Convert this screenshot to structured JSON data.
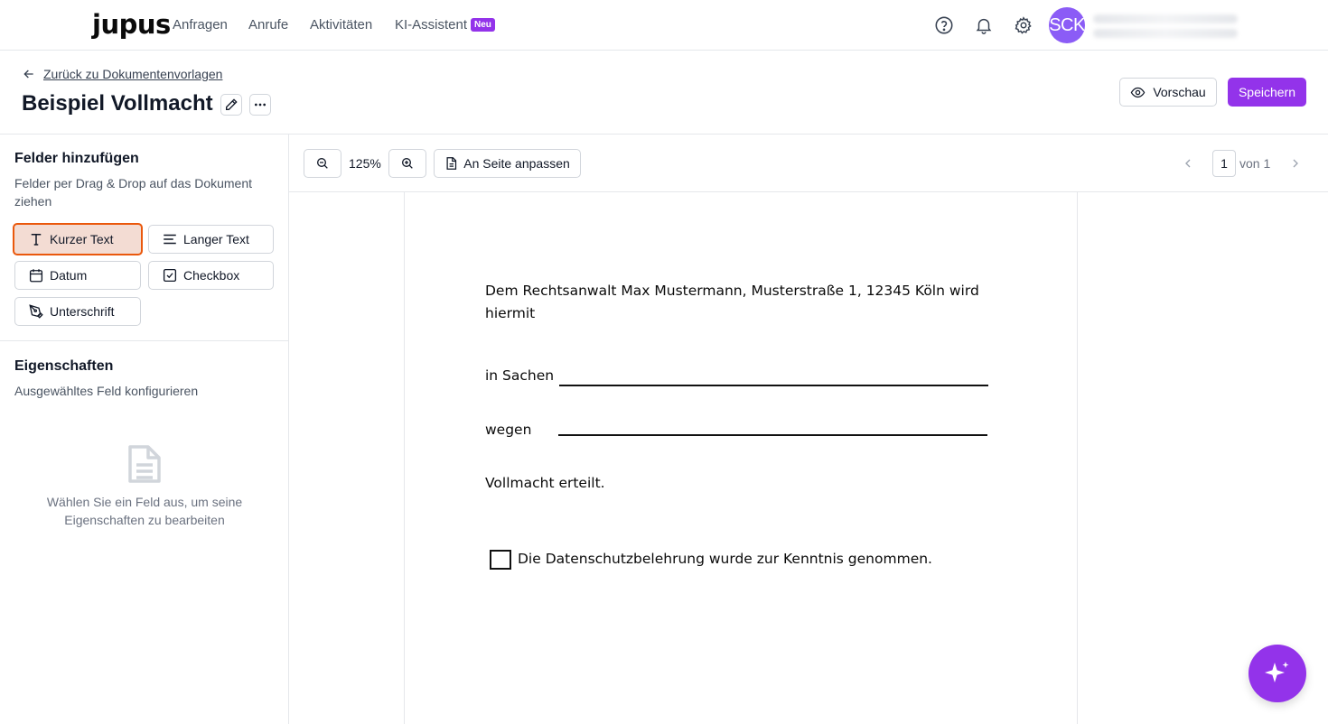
{
  "nav": {
    "logo": "jupus",
    "links": [
      "Anfragen",
      "Anrufe",
      "Aktivitäten",
      "KI-Assistent"
    ],
    "ki_badge": "Neu",
    "icons": [
      "help-circle-icon",
      "bell-icon",
      "gear-icon"
    ],
    "avatar_initials": "SCK"
  },
  "header": {
    "back_label": "Zurück zu Dokumentenvorlagen",
    "title": "Beispiel Vollmacht",
    "preview_label": "Vorschau",
    "save_label": "Speichern"
  },
  "sidebar": {
    "fields_title": "Felder hinzufügen",
    "fields_subtitle": "Felder per Drag & Drop auf das Dokument ziehen",
    "field_buttons": [
      {
        "label": "Kurzer Text",
        "icon": "text-icon",
        "active": true
      },
      {
        "label": "Langer Text",
        "icon": "lines-icon",
        "active": false
      },
      {
        "label": "Datum",
        "icon": "calendar-icon",
        "active": false
      },
      {
        "label": "Checkbox",
        "icon": "checkbox-icon",
        "active": false
      },
      {
        "label": "Unterschrift",
        "icon": "signature-pen-icon",
        "active": false
      }
    ],
    "props_title": "Eigenschaften",
    "props_subtitle": "Ausgewähltes Feld konfigurieren",
    "empty_text": "Wählen Sie ein Feld aus, um seine Eigenschaften zu bearbeiten"
  },
  "toolbar": {
    "zoom": "125%",
    "fit_label": "An Seite anpassen",
    "page_current": "1",
    "page_total": "von 1"
  },
  "document": {
    "intro_line1": "Dem Rechtsanwalt Max Mustermann, Musterstraße 1, 12345 Köln wird",
    "intro_line2": "hiermit",
    "sachen_label": "in Sachen",
    "wegen_label": "wegen",
    "vollmacht": "Vollmacht erteilt.",
    "checkbox_label": "Die Datenschutzbelehrung wurde zur Kenntnis genommen."
  },
  "colors": {
    "accent": "#9333ea",
    "active_field_border": "#ea580c",
    "active_field_bg": "#f3dcd3",
    "avatar": "#8b5cf6"
  }
}
